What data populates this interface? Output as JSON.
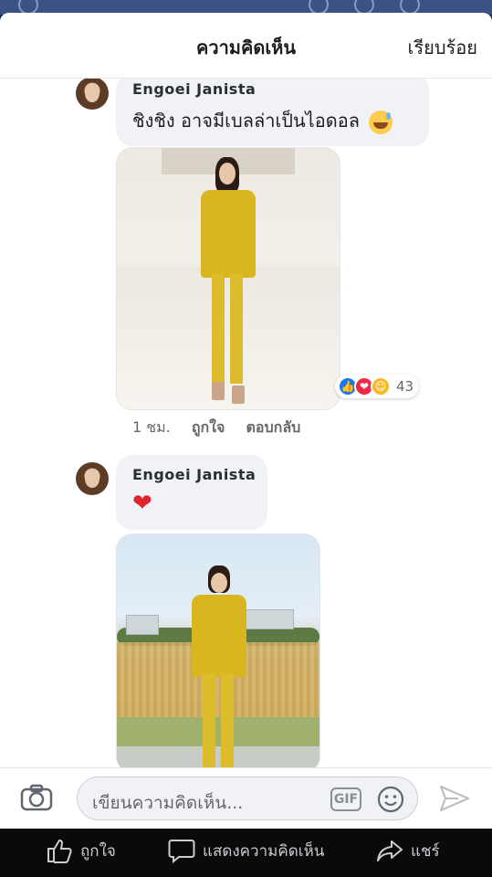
{
  "header": {
    "title": "ความคิดเห็น",
    "done_label": "เรียบร้อย"
  },
  "comments": [
    {
      "author": "Engoei Janista",
      "text": "ชิงชิง อาจมีเบลล่าเป็นไอดอล",
      "emoji": "grinning-sweat-emoji",
      "reaction_count": "43",
      "reactions": [
        "like",
        "love",
        "haha"
      ],
      "time": "1 ชม.",
      "like_label": "ถูกใจ",
      "reply_label": "ตอบกลับ"
    },
    {
      "author": "Engoei Janista",
      "emoji": "red-heart-emoji"
    }
  ],
  "composer": {
    "placeholder": "เขียนความคิดเห็น...",
    "gif_label": "GIF"
  },
  "bottom_bar": {
    "like_label": "ถูกใจ",
    "comment_label": "แสดงความคิดเห็น",
    "share_label": "แชร์"
  },
  "colors": {
    "like_blue": "#1877f2",
    "love_red": "#f0284a",
    "haha_yellow": "#f7b928",
    "suit_yellow": "#d9b51f"
  }
}
